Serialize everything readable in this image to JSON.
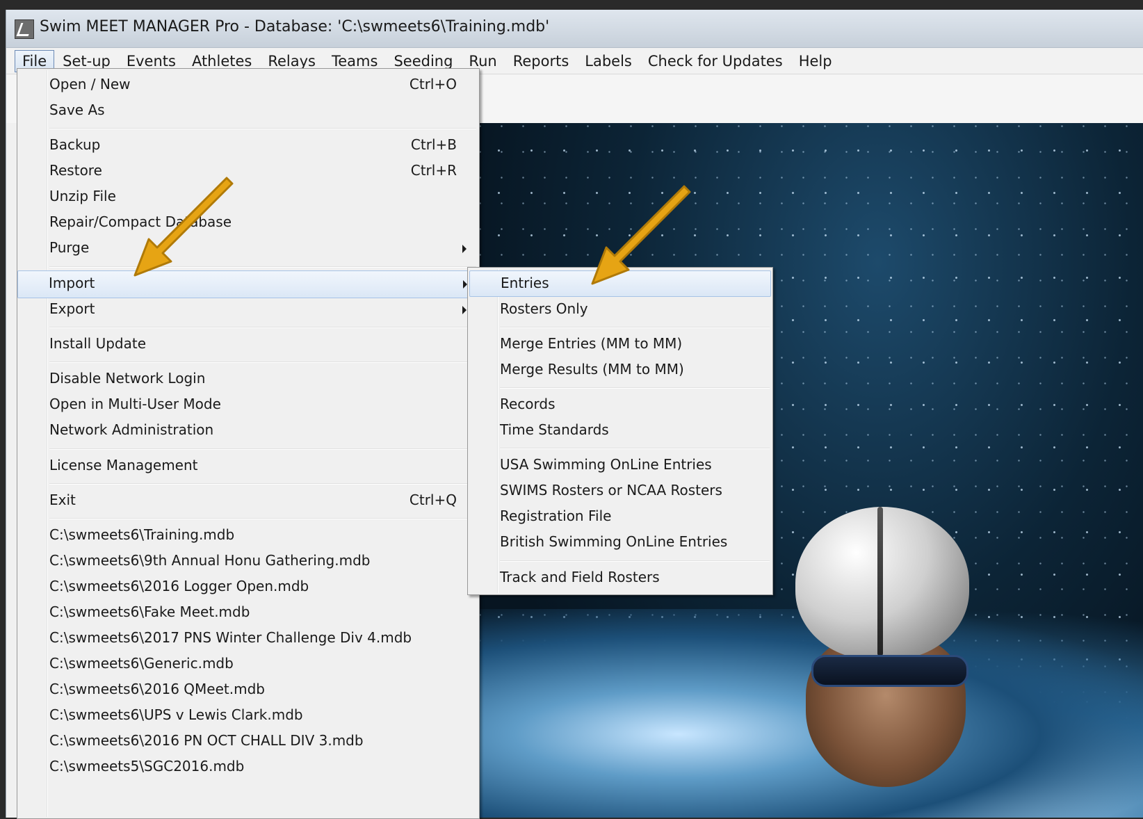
{
  "window": {
    "title": "Swim MEET MANAGER Pro - Database: 'C:\\swmeets6\\Training.mdb'"
  },
  "menubar": [
    "File",
    "Set-up",
    "Events",
    "Athletes",
    "Relays",
    "Teams",
    "Seeding",
    "Run",
    "Reports",
    "Labels",
    "Check for Updates",
    "Help"
  ],
  "file_menu": {
    "open_new": {
      "label": "Open / New",
      "shortcut": "Ctrl+O"
    },
    "save_as": {
      "label": "Save As"
    },
    "backup": {
      "label": "Backup",
      "shortcut": "Ctrl+B"
    },
    "restore": {
      "label": "Restore",
      "shortcut": "Ctrl+R"
    },
    "unzip": {
      "label": "Unzip File"
    },
    "repair": {
      "label": "Repair/Compact Database"
    },
    "purge": {
      "label": "Purge"
    },
    "import": {
      "label": "Import"
    },
    "export": {
      "label": "Export"
    },
    "install_update": {
      "label": "Install Update"
    },
    "disable_network": {
      "label": "Disable Network Login"
    },
    "multi_user": {
      "label": "Open in Multi-User Mode"
    },
    "network_admin": {
      "label": "Network Administration"
    },
    "license": {
      "label": "License Management"
    },
    "exit": {
      "label": "Exit",
      "shortcut": "Ctrl+Q"
    },
    "recent_files": [
      "C:\\swmeets6\\Training.mdb",
      "C:\\swmeets6\\9th Annual Honu Gathering.mdb",
      "C:\\swmeets6\\2016 Logger Open.mdb",
      "C:\\swmeets6\\Fake Meet.mdb",
      "C:\\swmeets6\\2017 PNS Winter Challenge Div 4.mdb",
      "C:\\swmeets6\\Generic.mdb",
      "C:\\swmeets6\\2016 QMeet.mdb",
      "C:\\swmeets6\\UPS v Lewis Clark.mdb",
      "C:\\swmeets6\\2016 PN OCT CHALL DIV 3.mdb",
      "C:\\swmeets5\\SGC2016.mdb"
    ]
  },
  "import_menu": {
    "entries": "Entries",
    "rosters_only": "Rosters Only",
    "merge_entries": "Merge Entries (MM to MM)",
    "merge_results": "Merge Results (MM to MM)",
    "records": "Records",
    "time_standards": "Time Standards",
    "usa_online": "USA Swimming OnLine Entries",
    "swims_rosters": "SWIMS Rosters or NCAA Rosters",
    "registration": "Registration File",
    "british_online": "British Swimming OnLine Entries",
    "track_field": "Track and Field Rosters"
  },
  "annotation_color": "#e6a414"
}
